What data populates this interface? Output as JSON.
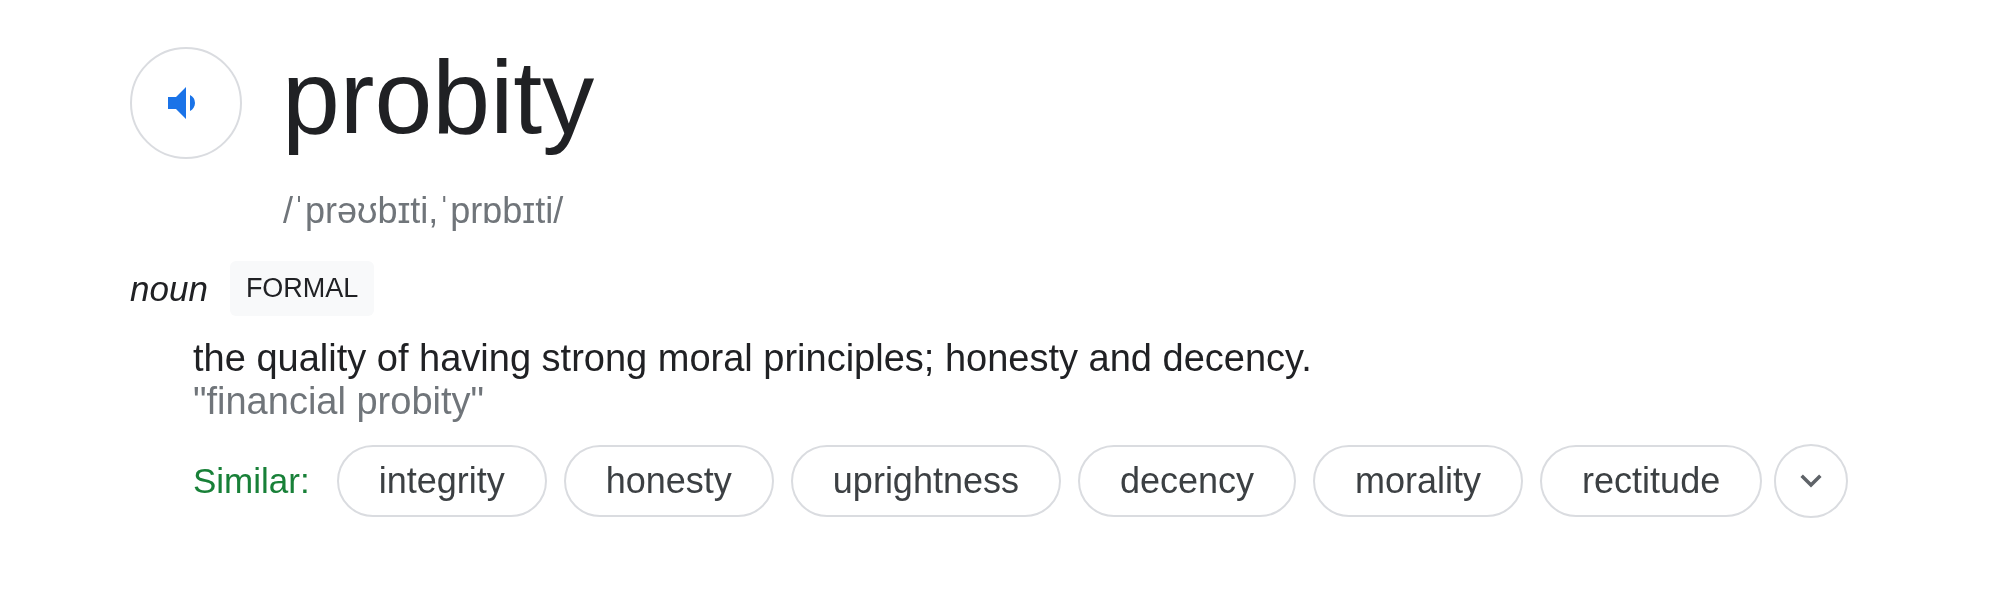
{
  "word": "probity",
  "pronunciation": "/ˈprəʊbɪti,ˈprɒbɪti/",
  "part_of_speech": "noun",
  "register_label": "FORMAL",
  "definition": "the quality of having strong moral principles; honesty and decency.",
  "example": "\"financial probity\"",
  "similar": {
    "label": "Similar:",
    "words": [
      "integrity",
      "honesty",
      "uprightness",
      "decency",
      "morality",
      "rectitude"
    ]
  }
}
